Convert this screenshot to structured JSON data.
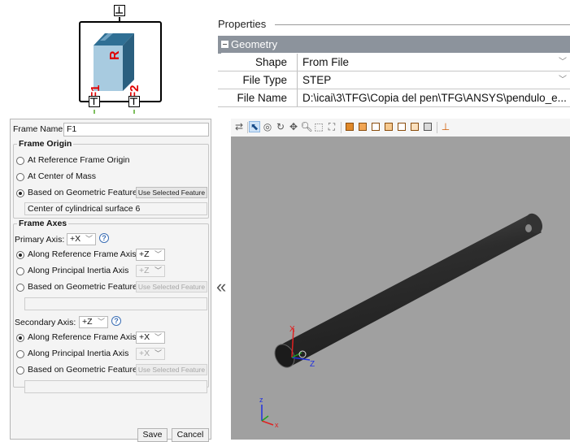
{
  "block": {
    "top_port": "⊥",
    "body_label": "R",
    "left_port_label": "F1",
    "right_port_label": "F2",
    "bottom_ports": [
      "⊤",
      "⊤"
    ]
  },
  "properties": {
    "title": "Properties",
    "section": "Geometry",
    "rows": [
      {
        "name": "Shape",
        "value": "From File"
      },
      {
        "name": "File Type",
        "value": "STEP"
      },
      {
        "name": "File Name",
        "value": "D:\\icai\\3\\TFG\\Copia del pen\\TFG\\ANSYS\\pendulo_e..."
      }
    ]
  },
  "frame": {
    "name_label": "Frame Name:",
    "name_value": "F1",
    "origin": {
      "title": "Frame Origin",
      "opt_ref": "At Reference Frame Origin",
      "opt_com": "At Center of Mass",
      "opt_geo": "Based on Geometric Feature",
      "use_selected": "Use Selected Feature",
      "feature_value": "Center of cylindrical surface 6"
    },
    "axes": {
      "title": "Frame Axes",
      "primary_label": "Primary Axis:",
      "primary_value": "+X",
      "primary_ref_label": "Along Reference Frame Axis",
      "primary_ref_value": "+Z",
      "primary_inertia_label": "Along Principal Inertia Axis",
      "primary_inertia_value": "+Z",
      "primary_geo_label": "Based on Geometric Feature",
      "use_selected": "Use Selected Feature",
      "secondary_label": "Secondary Axis:",
      "secondary_value": "+Z",
      "secondary_ref_label": "Along Reference Frame Axis",
      "secondary_ref_value": "+X",
      "secondary_inertia_label": "Along Principal Inertia Axis",
      "secondary_inertia_value": "+X",
      "secondary_geo_label": "Based on Geometric Feature"
    },
    "save": "Save",
    "cancel": "Cancel"
  },
  "collapse_glyph": "«",
  "viewer": {
    "axis_labels": {
      "x": "X",
      "z": "Z"
    },
    "triad_labels": {
      "z": "z",
      "x": "x"
    },
    "colors": {
      "background": "#a0a0a0",
      "rod": "#3a3a3a",
      "x_axis": "#e02020",
      "z_axis": "#2030e0"
    },
    "toolbar_icons": [
      "transform-icon",
      "select-icon",
      "orbit-icon",
      "rotate-icon",
      "pan-icon",
      "zoom-icon",
      "zoom-box-icon",
      "fit-icon",
      "view-front-icon",
      "view-back-icon",
      "view-left-icon",
      "view-right-icon",
      "view-top-icon",
      "view-bottom-icon",
      "view-iso-icon",
      "triad-icon"
    ]
  }
}
